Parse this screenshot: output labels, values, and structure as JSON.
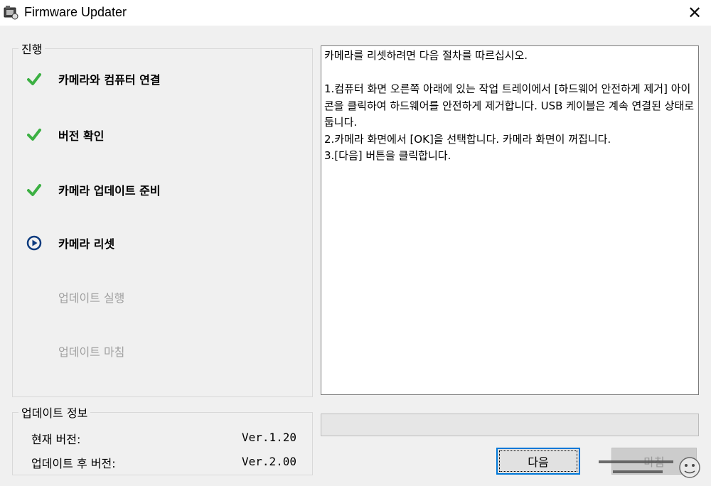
{
  "window": {
    "title": "Firmware Updater",
    "close_label": "✕"
  },
  "progress_group": {
    "label": "진행",
    "steps": [
      {
        "label": "카메라와 컴퓨터 연결",
        "state": "done"
      },
      {
        "label": "버전 확인",
        "state": "done"
      },
      {
        "label": "카메라 업데이트 준비",
        "state": "done"
      },
      {
        "label": "카메라 리셋",
        "state": "current"
      },
      {
        "label": "업데이트 실행",
        "state": "pending"
      },
      {
        "label": "업데이트 마침",
        "state": "pending"
      }
    ]
  },
  "message": {
    "text": "카메라를 리셋하려면 다음 절차를 따르십시오.\n\n1.컴퓨터 화면 오른쪽 아래에 있는 작업 트레이에서 [하드웨어 안전하게 제거] 아이콘을 클릭하여 하드웨어를 안전하게 제거합니다. USB 케이블은 계속 연결된 상태로 둡니다.\n2.카메라 화면에서 [OK]을 선택합니다. 카메라 화면이 꺼집니다.\n3.[다음] 버튼을 클릭합니다."
  },
  "update_info": {
    "label": "업데이트 정보",
    "current_version_label": "현재 버전:",
    "current_version_value": "Ver.1.20",
    "after_version_label": "업데이트 후 버전:",
    "after_version_value": "Ver.2.00"
  },
  "progress_bar": {
    "value": 0
  },
  "buttons": {
    "next_label": "다음",
    "finish_label": "마침"
  },
  "colors": {
    "check_green": "#3cb043",
    "current_blue": "#0b3a7e",
    "focus_border": "#0078d7"
  },
  "icons": {
    "done": "checkmark-icon",
    "current": "play-circle-icon"
  }
}
